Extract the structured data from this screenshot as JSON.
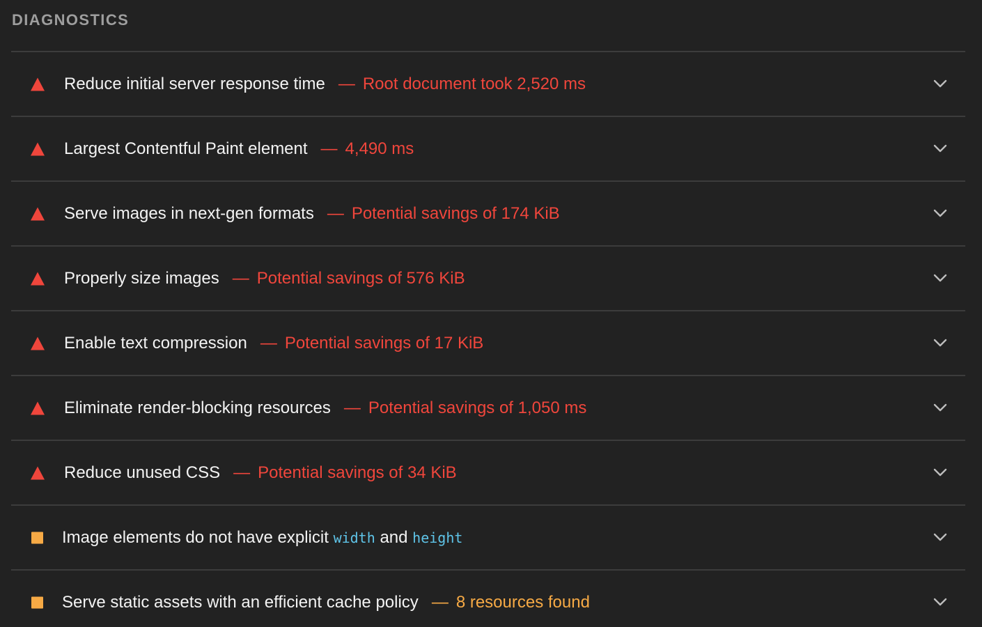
{
  "section": {
    "title": "DIAGNOSTICS"
  },
  "colors": {
    "fail": "#f0463c",
    "average": "#f7aa45",
    "code": "#5fc4e8",
    "background": "#222222",
    "divider": "#3c3c3c"
  },
  "audits": [
    {
      "status": "fail",
      "icon": "fail-triangle-icon",
      "title": "Reduce initial server response time",
      "separator": "—",
      "display": "Root document took 2,520 ms"
    },
    {
      "status": "fail",
      "icon": "fail-triangle-icon",
      "title": "Largest Contentful Paint element",
      "separator": "—",
      "display": "4,490 ms"
    },
    {
      "status": "fail",
      "icon": "fail-triangle-icon",
      "title": "Serve images in next-gen formats",
      "separator": "—",
      "display": "Potential savings of 174 KiB"
    },
    {
      "status": "fail",
      "icon": "fail-triangle-icon",
      "title": "Properly size images",
      "separator": "—",
      "display": "Potential savings of 576 KiB"
    },
    {
      "status": "fail",
      "icon": "fail-triangle-icon",
      "title": "Enable text compression",
      "separator": "—",
      "display": "Potential savings of 17 KiB"
    },
    {
      "status": "fail",
      "icon": "fail-triangle-icon",
      "title": "Eliminate render-blocking resources",
      "separator": "—",
      "display": "Potential savings of 1,050 ms"
    },
    {
      "status": "fail",
      "icon": "fail-triangle-icon",
      "title": "Reduce unused CSS",
      "separator": "—",
      "display": "Potential savings of 34 KiB"
    },
    {
      "status": "average",
      "icon": "average-square-icon",
      "title_prefix": "Image elements do not have explicit",
      "code_1": "width",
      "title_mid": "and",
      "code_2": "height"
    },
    {
      "status": "average",
      "icon": "average-square-icon",
      "title": "Serve static assets with an efficient cache policy",
      "separator": "—",
      "display": "8 resources found"
    }
  ]
}
